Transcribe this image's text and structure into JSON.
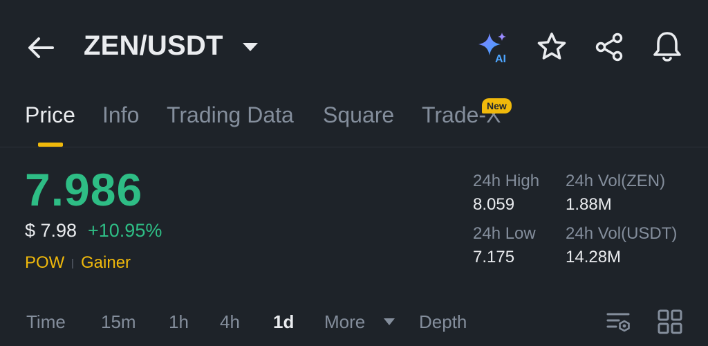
{
  "header": {
    "pair": "ZEN/USDT",
    "icons": {
      "back": "back-arrow-icon",
      "pair_dropdown": "caret-down-icon",
      "ai": "ai-sparkle-icon",
      "favorite": "star-icon",
      "share": "share-icon",
      "alert": "bell-icon"
    },
    "ai_label": "AI"
  },
  "tabs": {
    "items": [
      {
        "label": "Price",
        "active": true
      },
      {
        "label": "Info",
        "active": false
      },
      {
        "label": "Trading Data",
        "active": false
      },
      {
        "label": "Square",
        "active": false
      },
      {
        "label": "Trade-X",
        "active": false
      }
    ],
    "new_badge": "New"
  },
  "price": {
    "last": "7.986",
    "fiat": "$ 7.98",
    "change": "+10.95%",
    "tags": [
      "POW",
      "Gainer"
    ]
  },
  "stats": {
    "high_label": "24h High",
    "high_value": "8.059",
    "low_label": "24h Low",
    "low_value": "7.175",
    "vol_base_label": "24h Vol(ZEN)",
    "vol_base_value": "1.88M",
    "vol_quote_label": "24h Vol(USDT)",
    "vol_quote_value": "14.28M"
  },
  "intervals": {
    "items": [
      "Time",
      "15m",
      "1h",
      "4h",
      "1d",
      "More",
      "Depth"
    ],
    "active": "1d",
    "icons": {
      "more": "caret-down-icon",
      "indicators": "indicator-settings-icon",
      "layout": "grid-layout-icon"
    }
  },
  "colors": {
    "background": "#1e2329",
    "up": "#2ebd85",
    "accent": "#f0b90b",
    "text_primary": "#eaecef",
    "text_secondary": "#848e9c"
  }
}
